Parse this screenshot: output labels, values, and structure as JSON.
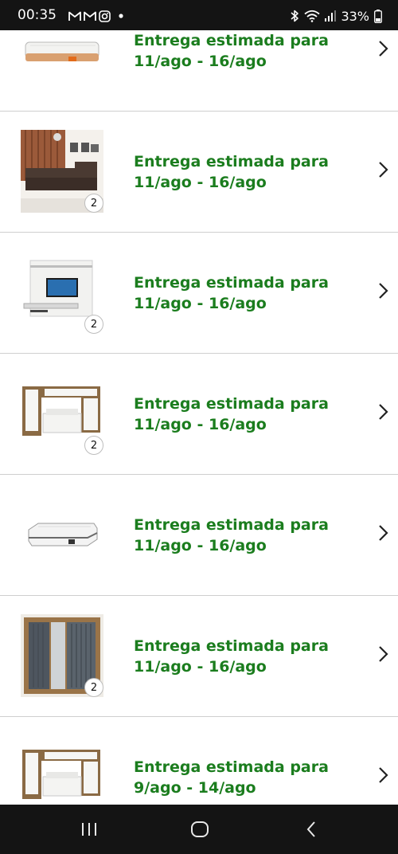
{
  "status_bar": {
    "time": "00:35",
    "left_icons": [
      "gmail-icon",
      "gmail-icon",
      "instagram-icon",
      "dot-icon"
    ],
    "right_icons": [
      "bluetooth-icon",
      "wifi-icon",
      "signal-icon"
    ],
    "battery": "33%"
  },
  "items": [
    {
      "image": "mattress-product-image",
      "badge": "",
      "delivery_text": "Entrega estimada para 11/ago - 16/ago"
    },
    {
      "image": "sofa-product-image",
      "badge": "2",
      "delivery_text": "Entrega estimada para 11/ago - 16/ago"
    },
    {
      "image": "tv-panel-product-image",
      "badge": "2",
      "delivery_text": "Entrega estimada para 11/ago - 16/ago"
    },
    {
      "image": "bedroom-set-product-image",
      "badge": "2",
      "delivery_text": "Entrega estimada para 11/ago - 16/ago"
    },
    {
      "image": "mattress-product-image",
      "badge": "",
      "delivery_text": "Entrega estimada para 11/ago - 16/ago"
    },
    {
      "image": "wardrobe-product-image",
      "badge": "2",
      "delivery_text": "Entrega estimada para 11/ago - 16/ago"
    },
    {
      "image": "bedroom-set-product-image",
      "badge": "",
      "delivery_text": "Entrega estimada para 9/ago - 14/ago"
    }
  ],
  "nav_bar": {
    "buttons": [
      "recent-apps-icon",
      "home-icon",
      "back-icon"
    ]
  },
  "colors": {
    "delivery_green": "#1b7d1e",
    "bar_background": "#141414",
    "divider": "#cfcfcf"
  }
}
